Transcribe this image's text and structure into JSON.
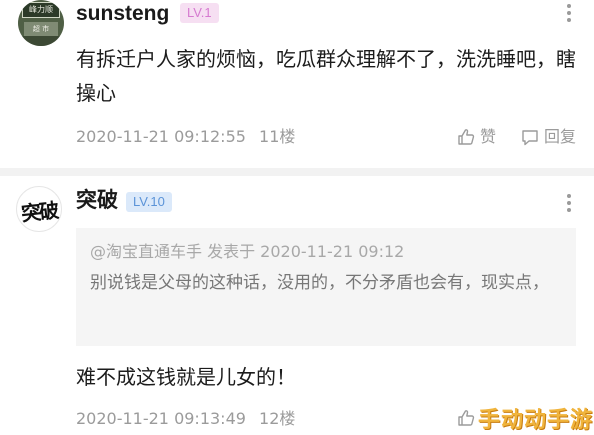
{
  "posts": [
    {
      "avatar": {
        "sign_text": "峰力顺",
        "shop_text": "超 市"
      },
      "username": "sunsteng",
      "level": "LV.1",
      "content": "有拆迁户人家的烦恼，吃瓜群众理解不了，洗洗睡吧，瞎操心",
      "timestamp": "2020-11-21 09:12:55",
      "floor": "11楼",
      "like_label": "赞",
      "reply_label": "回复"
    },
    {
      "avatar": {
        "text": "突破"
      },
      "username": "突破",
      "level": "LV.10",
      "quote": {
        "header": "@淘宝直通车手 发表于 2020-11-21 09:12",
        "body": "别说钱是父母的这种话，没用的，不分矛盾也会有，现实点，"
      },
      "content": "难不成这钱就是儿女的！",
      "timestamp": "2020-11-21 09:13:49",
      "floor": "12楼"
    }
  ],
  "watermark": "手动动手游",
  "colors": {
    "lv1_badge_bg": "#f6dff2",
    "lv1_badge_text": "#d67ad0",
    "lv10_badge_bg": "#dbe9fa",
    "lv10_badge_text": "#5b93d8",
    "meta_text": "#9b9b9b"
  }
}
